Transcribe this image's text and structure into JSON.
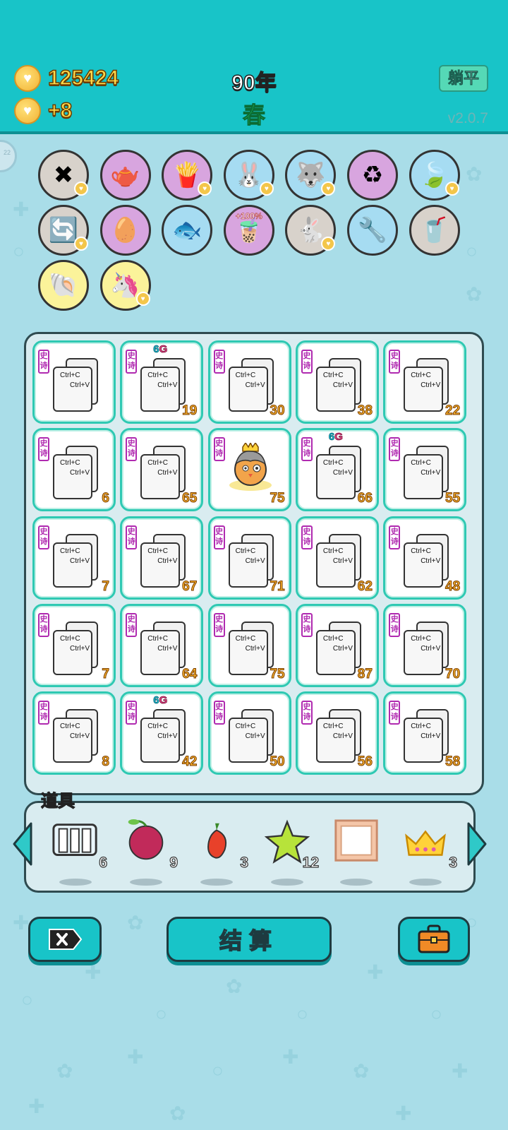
{
  "header": {
    "coins": "125424",
    "coin_delta": "+8",
    "year": "90年",
    "season": "春",
    "tangping_label": "躺平",
    "version": "v2.0.7",
    "side_tab": "22"
  },
  "buffs": [
    {
      "name": "cancel-tag-buff",
      "icon": "x-tag-icon",
      "bg": "gray",
      "heart": true,
      "glyph": "✖"
    },
    {
      "name": "gravy-boat-buff",
      "icon": "gravy-boat-icon",
      "bg": "purple",
      "heart": false,
      "glyph": "🫖"
    },
    {
      "name": "fries-buff",
      "icon": "fries-icon",
      "bg": "purple",
      "heart": true,
      "glyph": "🍟"
    },
    {
      "name": "white-rabbit-buff",
      "icon": "rabbit-icon",
      "bg": "blue",
      "heart": true,
      "glyph": "🐰"
    },
    {
      "name": "husky-buff",
      "icon": "husky-dog-icon",
      "bg": "blue",
      "heart": true,
      "glyph": "🐺"
    },
    {
      "name": "recycle-buff",
      "icon": "recycle-icon",
      "bg": "purple",
      "heart": false,
      "glyph": "♻"
    },
    {
      "name": "leaf-buff",
      "icon": "leaf-icon",
      "bg": "blue",
      "heart": true,
      "glyph": "🍃"
    },
    {
      "name": "refresh-buff",
      "icon": "refresh-icon",
      "bg": "gray",
      "heart": true,
      "glyph": "🔄"
    },
    {
      "name": "egg-buff",
      "icon": "egg-icon",
      "bg": "purple",
      "heart": false,
      "glyph": "🥚"
    },
    {
      "name": "fish-bowl-buff",
      "icon": "fish-bowl-icon",
      "bg": "blue",
      "heart": false,
      "glyph": "🐟"
    },
    {
      "name": "milk-tea-plus-buff",
      "icon": "milk-tea-icon",
      "bg": "purple",
      "heart": false,
      "glyph": "🧋",
      "label": "+100%"
    },
    {
      "name": "rabbit-buff",
      "icon": "rabbit-icon",
      "bg": "gray",
      "heart": true,
      "glyph": "🐇"
    },
    {
      "name": "wrench-shield-buff",
      "icon": "wrench-shield-icon",
      "bg": "blue",
      "heart": false,
      "glyph": "🔧"
    },
    {
      "name": "boba-buff",
      "icon": "boba-cup-icon",
      "bg": "gray",
      "heart": false,
      "glyph": "🥤"
    },
    {
      "name": "shell-buff",
      "icon": "shell-icon",
      "bg": "yellow",
      "heart": false,
      "glyph": "🐚"
    },
    {
      "name": "unicorn-buff",
      "icon": "unicorn-icon",
      "bg": "yellow",
      "heart": true,
      "glyph": "🦄"
    }
  ],
  "card": {
    "tag": "史诗",
    "line1": "Ctrl+C",
    "line2": "Ctrl+V",
    "sixg_six": "6",
    "sixg_g": "G"
  },
  "grid": [
    [
      {
        "num": "",
        "sixg": false
      },
      {
        "num": "19",
        "sixg": true
      },
      {
        "num": "30",
        "sixg": false
      },
      {
        "num": "38",
        "sixg": false
      },
      {
        "num": "22",
        "sixg": false
      }
    ],
    [
      {
        "num": "6",
        "sixg": false
      },
      {
        "num": "65",
        "sixg": false
      },
      {
        "num": "75",
        "sixg": false,
        "hero": true
      },
      {
        "num": "66",
        "sixg": true
      },
      {
        "num": "55",
        "sixg": false
      }
    ],
    [
      {
        "num": "7",
        "sixg": false
      },
      {
        "num": "67",
        "sixg": false
      },
      {
        "num": "71",
        "sixg": false
      },
      {
        "num": "62",
        "sixg": false
      },
      {
        "num": "48",
        "sixg": false
      }
    ],
    [
      {
        "num": "7",
        "sixg": false
      },
      {
        "num": "64",
        "sixg": false
      },
      {
        "num": "75",
        "sixg": false
      },
      {
        "num": "87",
        "sixg": false
      },
      {
        "num": "70",
        "sixg": false
      }
    ],
    [
      {
        "num": "8",
        "sixg": false
      },
      {
        "num": "42",
        "sixg": true
      },
      {
        "num": "50",
        "sixg": false
      },
      {
        "num": "56",
        "sixg": false
      },
      {
        "num": "58",
        "sixg": false
      }
    ]
  ],
  "props": {
    "label": "道具",
    "items": [
      {
        "name": "tubes-prop",
        "icon": "test-tubes-icon",
        "count": "6"
      },
      {
        "name": "bayberry-prop",
        "icon": "bayberry-icon",
        "count": "9"
      },
      {
        "name": "chili-prop",
        "icon": "chili-pepper-icon",
        "count": "3"
      },
      {
        "name": "star-prop",
        "icon": "star-icon",
        "count": "12"
      },
      {
        "name": "frame-prop",
        "icon": "picture-frame-icon",
        "count": ""
      },
      {
        "name": "crown-prop",
        "icon": "crown-icon",
        "count": "3"
      }
    ]
  },
  "bottom": {
    "settle_label": "结算"
  },
  "colors": {
    "header": "#18c4c8",
    "background": "#a9dde8",
    "cell_border": "#2fc9b3",
    "number_fill": "#f7b02c",
    "epic_tag": "#b02ab0"
  }
}
